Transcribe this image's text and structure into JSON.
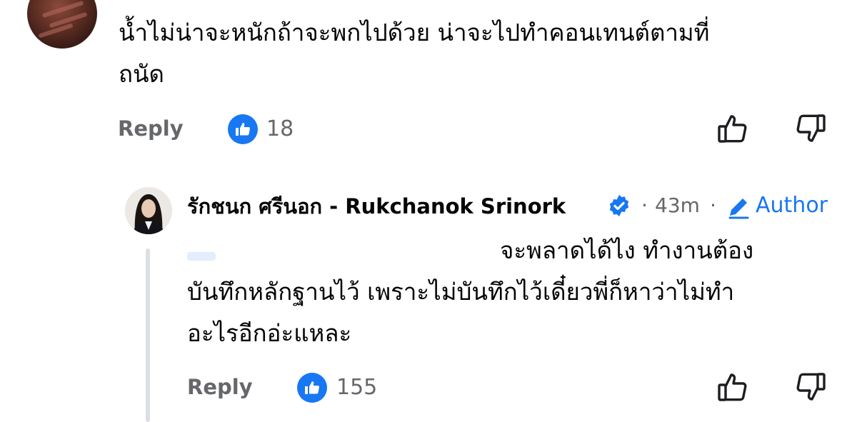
{
  "comments": [
    {
      "text_line1": "น้ำไม่น่าจะหนักถ้าจะพกไปด้วย น่าจะไปทำคอนเทนต์ตามที่",
      "text_line2": "ถนัด",
      "reply_label": "Reply",
      "like_count": "18"
    },
    {
      "author": "รักชนก ศรีนอก - Rukchanok Srinork",
      "time": "43m",
      "meta_separator": "·",
      "author_label": "Author",
      "text_line1": "จะพลาดได้ไง ทำงานต้อง",
      "text_line2": "บันทึกหลักฐานไว้ เพราะไม่บันทึกไว้เดี๋ยวพี่ก็หาว่าไม่ทำ",
      "text_line3": "อะไรอีกอ่ะแหละ",
      "reply_label": "Reply",
      "like_count": "155"
    }
  ],
  "colors": {
    "accent": "#1877f2",
    "secondary_text": "#65676b",
    "thread_line": "#dcdfe3"
  },
  "icons": [
    "like-badge-icon",
    "thumbs-up-icon",
    "thumbs-down-icon",
    "verified-badge-icon",
    "pencil-icon"
  ]
}
